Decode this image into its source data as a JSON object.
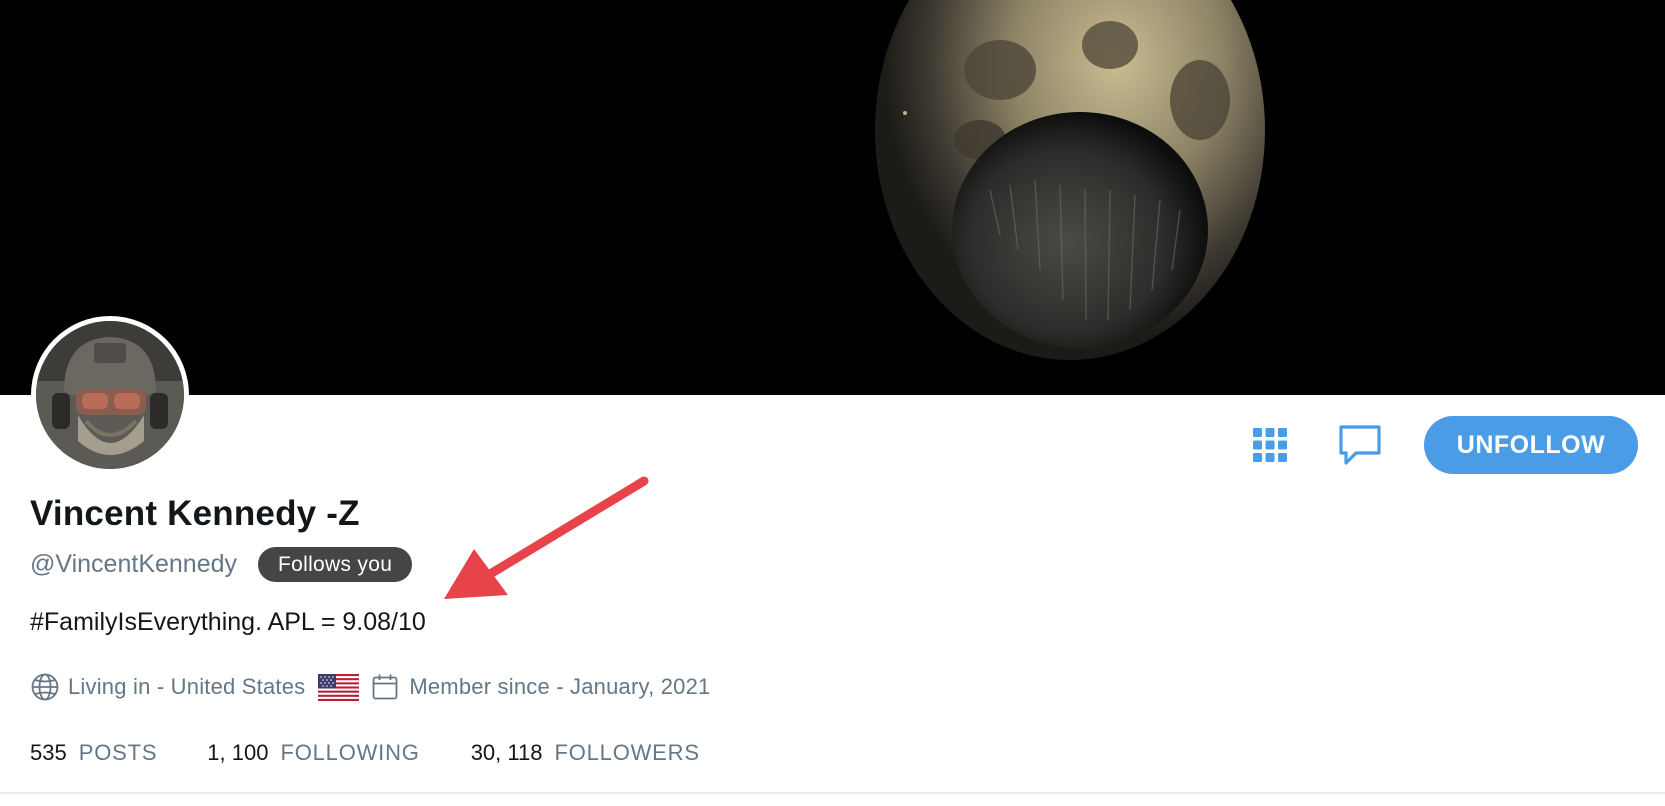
{
  "profile": {
    "display_name": "Vincent Kennedy -Z",
    "handle": "@VincentKennedy",
    "follows_you": "Follows you",
    "bio": "#FamilyIsEverything. APL = 9.08/10",
    "location": "Living in - United States",
    "member_since": "Member since - January, 2021"
  },
  "stats": {
    "posts_count": "535",
    "posts_label": "POSTS",
    "following_count": "1, 100",
    "following_label": "FOLLOWING",
    "followers_count": "30, 118",
    "followers_label": "FOLLOWERS"
  },
  "actions": {
    "unfollow_label": "UNFOLLOW"
  },
  "icons": {
    "grid": "grid-icon",
    "message": "message-icon",
    "globe": "globe-icon",
    "flag": "us-flag-icon",
    "calendar": "calendar-icon"
  },
  "colors": {
    "accent": "#4a9ce6",
    "muted_text": "#657786",
    "badge_bg": "#454545",
    "annotation_arrow": "#e8424a"
  }
}
